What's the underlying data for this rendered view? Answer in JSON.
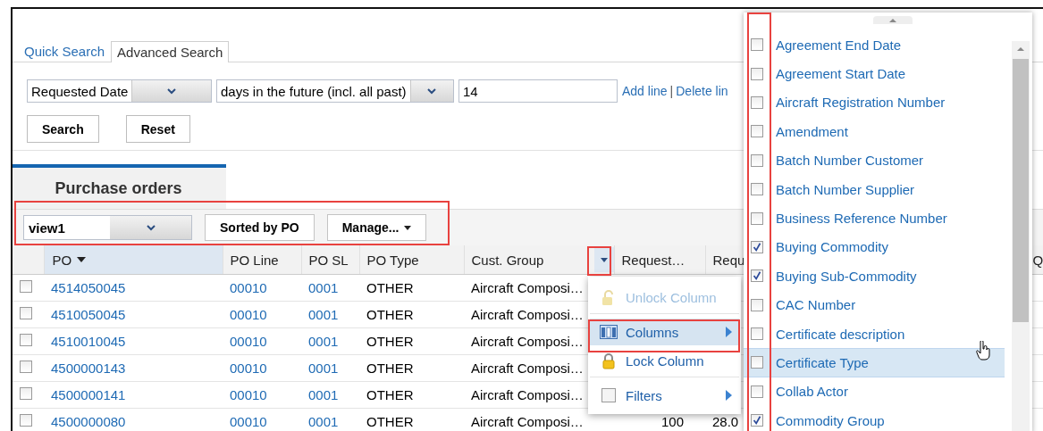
{
  "search_tabs": [
    {
      "label": "Quick Search",
      "selected": false
    },
    {
      "label": "Advanced Search",
      "selected": true
    }
  ],
  "criteria": {
    "field": "Requested Date",
    "operator": "days in the future (incl. all past)",
    "value": "14",
    "links": [
      "Add line",
      "Delete lin"
    ],
    "link_separator": "|"
  },
  "search_buttons": [
    "Search",
    "Reset"
  ],
  "results_tab": {
    "label": "Purchase orders",
    "selected": true
  },
  "toolbar": {
    "view": "view1",
    "sort_button": "Sorted by PO",
    "manage_button": "Manage..."
  },
  "table": {
    "columns": [
      {
        "label": "PO",
        "sorted": true,
        "menu_open": false,
        "kind": "link"
      },
      {
        "label": "PO Line",
        "sorted": false,
        "menu_open": false,
        "kind": "link"
      },
      {
        "label": "PO SL",
        "sorted": false,
        "menu_open": false,
        "kind": "link"
      },
      {
        "label": "PO Type",
        "sorted": false,
        "menu_open": false,
        "kind": "text"
      },
      {
        "label": "Cust. Group",
        "sorted": false,
        "menu_open": true,
        "kind": "text"
      },
      {
        "label": "Request…",
        "sorted": false,
        "menu_open": false,
        "kind": "number"
      },
      {
        "label": "Requ",
        "sorted": false,
        "menu_open": false,
        "kind": "text"
      },
      {
        "label": "Q",
        "sorted": false,
        "menu_open": false,
        "kind": "text"
      }
    ],
    "rows": [
      {
        "checked": false,
        "cells": [
          "4514050045",
          "00010",
          "0001",
          "OTHER",
          "Aircraft Composi…"
        ]
      },
      {
        "checked": false,
        "cells": [
          "4510050045",
          "00010",
          "0001",
          "OTHER",
          "Aircraft Composi…"
        ]
      },
      {
        "checked": false,
        "cells": [
          "4510010045",
          "00010",
          "0001",
          "OTHER",
          "Aircraft Composi…"
        ]
      },
      {
        "checked": false,
        "cells": [
          "4500000143",
          "00010",
          "0001",
          "OTHER",
          "Aircraft Composi…"
        ]
      },
      {
        "checked": false,
        "cells": [
          "4500000141",
          "00010",
          "0001",
          "OTHER",
          "Aircraft Composi…"
        ]
      },
      {
        "checked": false,
        "cells": [
          "4500000080",
          "00010",
          "0001",
          "OTHER",
          "Aircraft Composi…",
          "100",
          "28.0"
        ]
      }
    ]
  },
  "column_menu": {
    "items": [
      {
        "label": "Unlock Column",
        "disabled": true,
        "selected": false,
        "submenu": false,
        "divider_after": true
      },
      {
        "label": "Columns",
        "disabled": false,
        "selected": true,
        "submenu": true,
        "divider_after": false
      },
      {
        "label": "Lock Column",
        "disabled": false,
        "selected": false,
        "submenu": false,
        "divider_after": true
      },
      {
        "label": "Filters",
        "disabled": false,
        "selected": false,
        "submenu": true,
        "divider_after": false
      }
    ]
  },
  "column_chooser": {
    "items": [
      {
        "label": "Agreement End Date",
        "checked": false,
        "selected": false
      },
      {
        "label": "Agreement Start Date",
        "checked": false,
        "selected": false
      },
      {
        "label": "Aircraft Registration Number",
        "checked": false,
        "selected": false
      },
      {
        "label": "Amendment",
        "checked": false,
        "selected": false
      },
      {
        "label": "Batch Number Customer",
        "checked": false,
        "selected": false
      },
      {
        "label": "Batch Number Supplier",
        "checked": false,
        "selected": false
      },
      {
        "label": "Business Reference Number",
        "checked": false,
        "selected": false
      },
      {
        "label": "Buying Commodity",
        "checked": true,
        "selected": false
      },
      {
        "label": "Buying Sub-Commodity",
        "checked": true,
        "selected": false
      },
      {
        "label": "CAC Number",
        "checked": false,
        "selected": false
      },
      {
        "label": "Certificate description",
        "checked": false,
        "selected": false
      },
      {
        "label": "Certificate Type",
        "checked": false,
        "selected": true
      },
      {
        "label": "Collab Actor",
        "checked": false,
        "selected": false
      },
      {
        "label": "Commodity Group",
        "checked": true,
        "selected": false
      }
    ]
  }
}
